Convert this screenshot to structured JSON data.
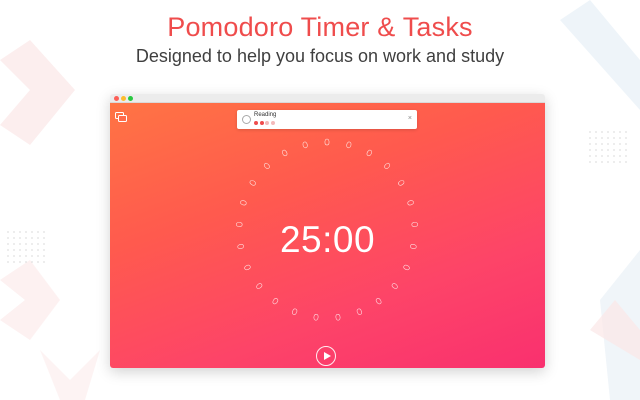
{
  "promo": {
    "title": "Pomodoro Timer & Tasks",
    "subtitle": "Designed to help you focus on work and study"
  },
  "window_controls": [
    "close-button",
    "minimize-button",
    "maximize-button"
  ],
  "sidebar_toggle_icon": "sidebar-toggle-icon",
  "task": {
    "name": "Reading",
    "pomodoros_total": 4,
    "pomodoros_done": 2,
    "close_label": "×"
  },
  "timer": {
    "display": "25:00",
    "tick_count": 25
  },
  "controls": {
    "play_icon": "play-icon"
  },
  "colors": {
    "accent": "#ef4c4c",
    "gradient_start": "#ff7444",
    "gradient_end": "#f9306f",
    "dot_done": "#ef4c4c",
    "dot_pending": "#f4b9b9"
  }
}
